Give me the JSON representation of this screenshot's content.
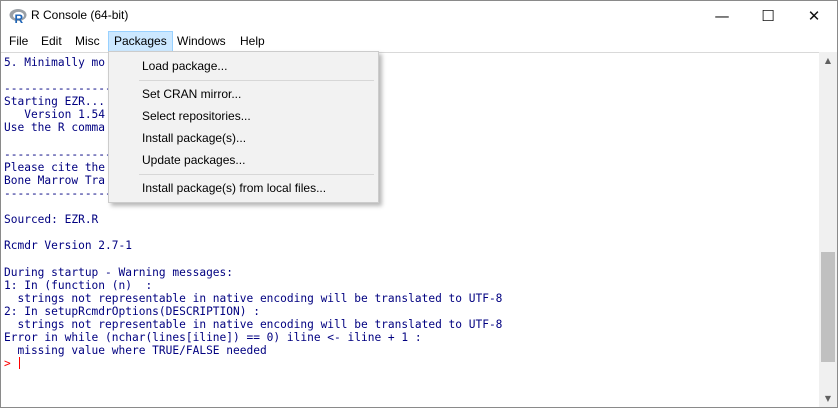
{
  "window": {
    "title": "R Console (64-bit)",
    "controls": {
      "minimize": "—",
      "maximize": "☐",
      "close": "✕"
    }
  },
  "menubar": {
    "items": [
      "File",
      "Edit",
      "Misc",
      "Packages",
      "Windows",
      "Help"
    ],
    "active": "Packages"
  },
  "packages_menu": {
    "items": [
      "Load package...",
      "Set CRAN mirror...",
      "Select repositories...",
      "Install package(s)...",
      "Update packages...",
      "Install package(s) from local files..."
    ]
  },
  "console": {
    "lines": [
      "5. Minimally mo",
      "",
      "----------------",
      "Starting EZR...",
      "   Version 1.54",
      "Use the R comma",
      "",
      "----------------",
      "Please cite the",
      "Bone Marrow Tra",
      "-----------------------------------",
      "",
      "Sourced: EZR.R",
      "",
      "Rcmdr Version 2.7-1",
      "",
      "During startup - Warning messages:",
      "1: In (function (n)  :",
      "  strings not representable in native encoding will be translated to UTF-8",
      "2: In setupRcmdrOptions(DESCRIPTION) :",
      "  strings not representable in native encoding will be translated to UTF-8",
      "Error in while (nchar(lines[iline]) == 0) iline <- iline + 1 :",
      "  missing value where TRUE/FALSE needed"
    ],
    "prompt": ">"
  },
  "colors": {
    "console_text": "#000080",
    "prompt": "#ff0000",
    "menu_highlight": "#cce8ff"
  }
}
